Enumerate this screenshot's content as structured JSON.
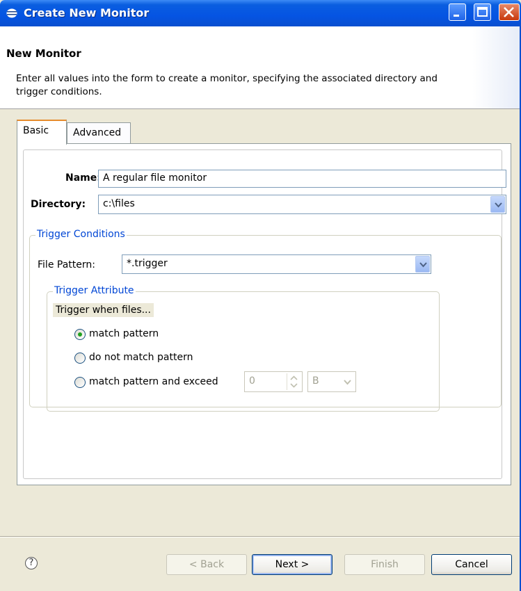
{
  "window": {
    "title": "Create New Monitor"
  },
  "header": {
    "title": "New Monitor",
    "description": "Enter all values into the form to create a monitor, specifying the associated directory and trigger conditions."
  },
  "tabs": [
    {
      "label": "Basic",
      "active": true
    },
    {
      "label": "Advanced",
      "active": false
    }
  ],
  "form": {
    "name_label": "Name:",
    "name_value": "A regular file monitor",
    "directory_label": "Directory:",
    "directory_value": "c:\\files",
    "trigger_conditions": {
      "title": "Trigger Conditions",
      "file_pattern_label": "File Pattern:",
      "file_pattern_value": "*.trigger",
      "trigger_attribute": {
        "title": "Trigger Attribute",
        "prompt": "Trigger when files...",
        "options": [
          {
            "label": "match pattern",
            "selected": true
          },
          {
            "label": "do not match pattern",
            "selected": false
          },
          {
            "label": "match pattern and exceed",
            "selected": false
          }
        ],
        "size_value": "0",
        "size_unit": "B"
      }
    }
  },
  "buttons": {
    "back": "< Back",
    "next": "Next >",
    "finish": "Finish",
    "cancel": "Cancel"
  },
  "colors": {
    "titlebar": "#0554e3",
    "group_title": "#0046d5",
    "radio_selected": "#21a121",
    "tab_accent": "#e68b2c"
  }
}
